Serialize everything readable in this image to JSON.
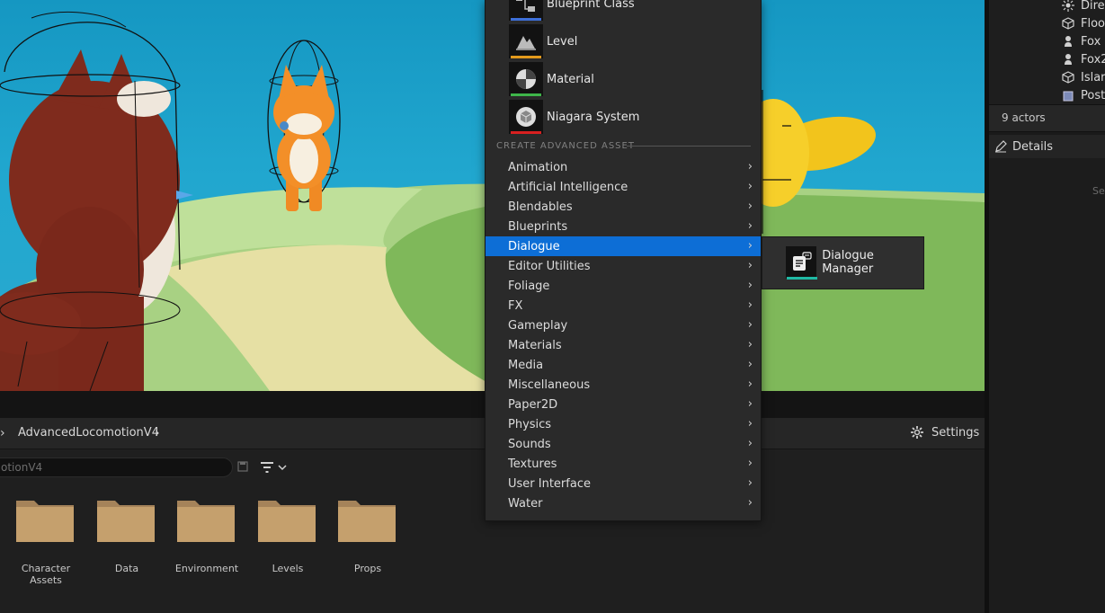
{
  "outliner": {
    "rows": [
      {
        "label": "Dire",
        "icon": "light-icon"
      },
      {
        "label": "Floo",
        "icon": "mesh-icon"
      },
      {
        "label": "Fox",
        "icon": "character-icon"
      },
      {
        "label": "Fox2",
        "icon": "character-icon"
      },
      {
        "label": "Islar",
        "icon": "mesh-icon"
      },
      {
        "label": "Post",
        "icon": "volume-icon"
      }
    ],
    "actors_count": "9 actors"
  },
  "details": {
    "tab_label": "Details",
    "hint": "Se"
  },
  "content_browser": {
    "breadcrumb": "AdvancedLocomotionV4",
    "settings_label": "Settings",
    "search_value": "otionV4",
    "folders": [
      {
        "name": "Character Assets"
      },
      {
        "name": "Data"
      },
      {
        "name": "Environment"
      },
      {
        "name": "Levels"
      },
      {
        "name": "Props"
      }
    ]
  },
  "context_menu": {
    "basic_assets": [
      {
        "label": "Blueprint Class",
        "icon": "blueprint-class-icon",
        "color": "#3d6fd8"
      },
      {
        "label": "Level",
        "icon": "level-icon",
        "color": "#e39a1c"
      },
      {
        "label": "Material",
        "icon": "material-icon",
        "color": "#3eb54a"
      },
      {
        "label": "Niagara System",
        "icon": "niagara-icon",
        "color": "#d82020"
      }
    ],
    "advanced_header": "CREATE ADVANCED ASSET",
    "advanced_items": [
      "Animation",
      "Artificial Intelligence",
      "Blendables",
      "Blueprints",
      "Dialogue",
      "Editor Utilities",
      "Foliage",
      "FX",
      "Gameplay",
      "Materials",
      "Media",
      "Miscellaneous",
      "Paper2D",
      "Physics",
      "Sounds",
      "Textures",
      "User Interface",
      "Water"
    ],
    "selected": "Dialogue",
    "selection_color": "#0d6ed6"
  },
  "submenu": {
    "label": "Dialogue Manager",
    "icon": "dialogue-manager-icon",
    "color": "#1fb9a4"
  }
}
